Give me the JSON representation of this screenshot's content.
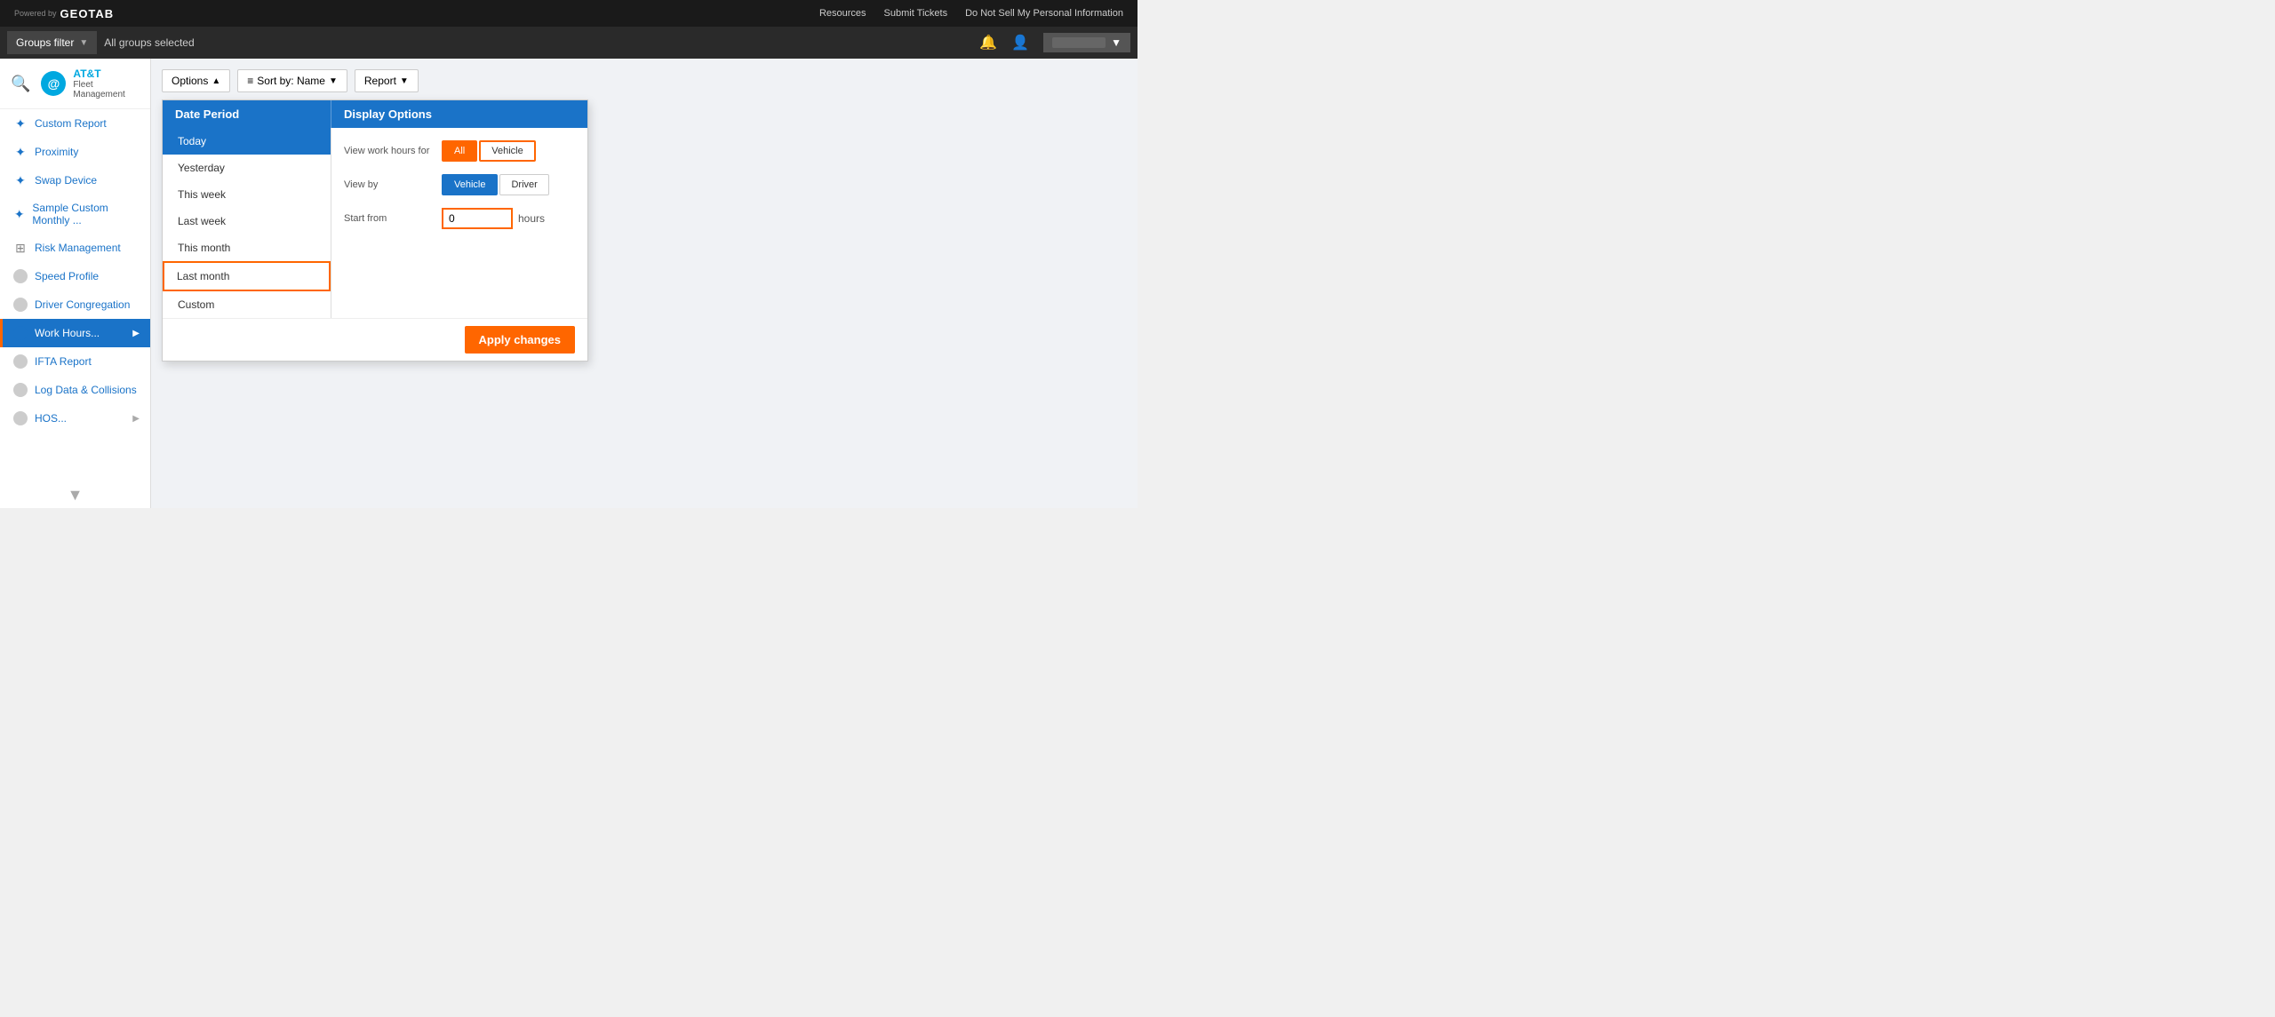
{
  "topnav": {
    "resources": "Resources",
    "submit_tickets": "Submit Tickets",
    "do_not_sell": "Do Not Sell My Personal Information"
  },
  "groupsbar": {
    "filter_label": "Groups filter",
    "all_groups": "All groups selected"
  },
  "sidebar": {
    "logo_name": "AT&T",
    "logo_sub": "Fleet Management",
    "items": [
      {
        "label": "Custom Report",
        "icon": "puzzle",
        "active": false
      },
      {
        "label": "Proximity",
        "icon": "puzzle-blue",
        "active": false
      },
      {
        "label": "Swap Device",
        "icon": "puzzle-blue",
        "active": false
      },
      {
        "label": "Sample Custom Monthly ...",
        "icon": "puzzle-blue",
        "active": false
      },
      {
        "label": "Risk Management",
        "icon": "chart",
        "active": false
      },
      {
        "label": "Speed Profile",
        "icon": "circle",
        "active": false
      },
      {
        "label": "Driver Congregation",
        "icon": "circle",
        "active": false
      },
      {
        "label": "Work Hours...",
        "icon": "circle-blue",
        "active": true,
        "has_arrow": true
      },
      {
        "label": "IFTA Report",
        "icon": "circle",
        "active": false
      },
      {
        "label": "Log Data & Collisions",
        "icon": "circle",
        "active": false
      },
      {
        "label": "HOS...",
        "icon": "circle",
        "active": false,
        "has_arrow": true
      }
    ]
  },
  "toolbar": {
    "options_label": "Options",
    "sort_label": "Sort by:  Name",
    "report_label": "Report"
  },
  "options_panel": {
    "date_period_header": "Date Period",
    "display_options_header": "Display Options",
    "date_items": [
      {
        "label": "Today",
        "active": true,
        "highlighted": false
      },
      {
        "label": "Yesterday",
        "active": false,
        "highlighted": false
      },
      {
        "label": "This week",
        "active": false,
        "highlighted": false
      },
      {
        "label": "Last week",
        "active": false,
        "highlighted": false
      },
      {
        "label": "This month",
        "active": false,
        "highlighted": false
      },
      {
        "label": "Last month",
        "active": false,
        "highlighted": true
      },
      {
        "label": "Custom",
        "active": false,
        "highlighted": false
      }
    ],
    "view_work_hours_label": "View work hours for",
    "view_work_hours_options": [
      {
        "label": "All",
        "active": true
      },
      {
        "label": "Vehicle",
        "active": false
      }
    ],
    "view_by_label": "View by",
    "view_by_options": [
      {
        "label": "Vehicle",
        "active": true
      },
      {
        "label": "Driver",
        "active": false
      }
    ],
    "start_from_label": "Start from",
    "start_from_value": "0",
    "hours_label": "hours",
    "apply_btn_label": "Apply changes"
  }
}
